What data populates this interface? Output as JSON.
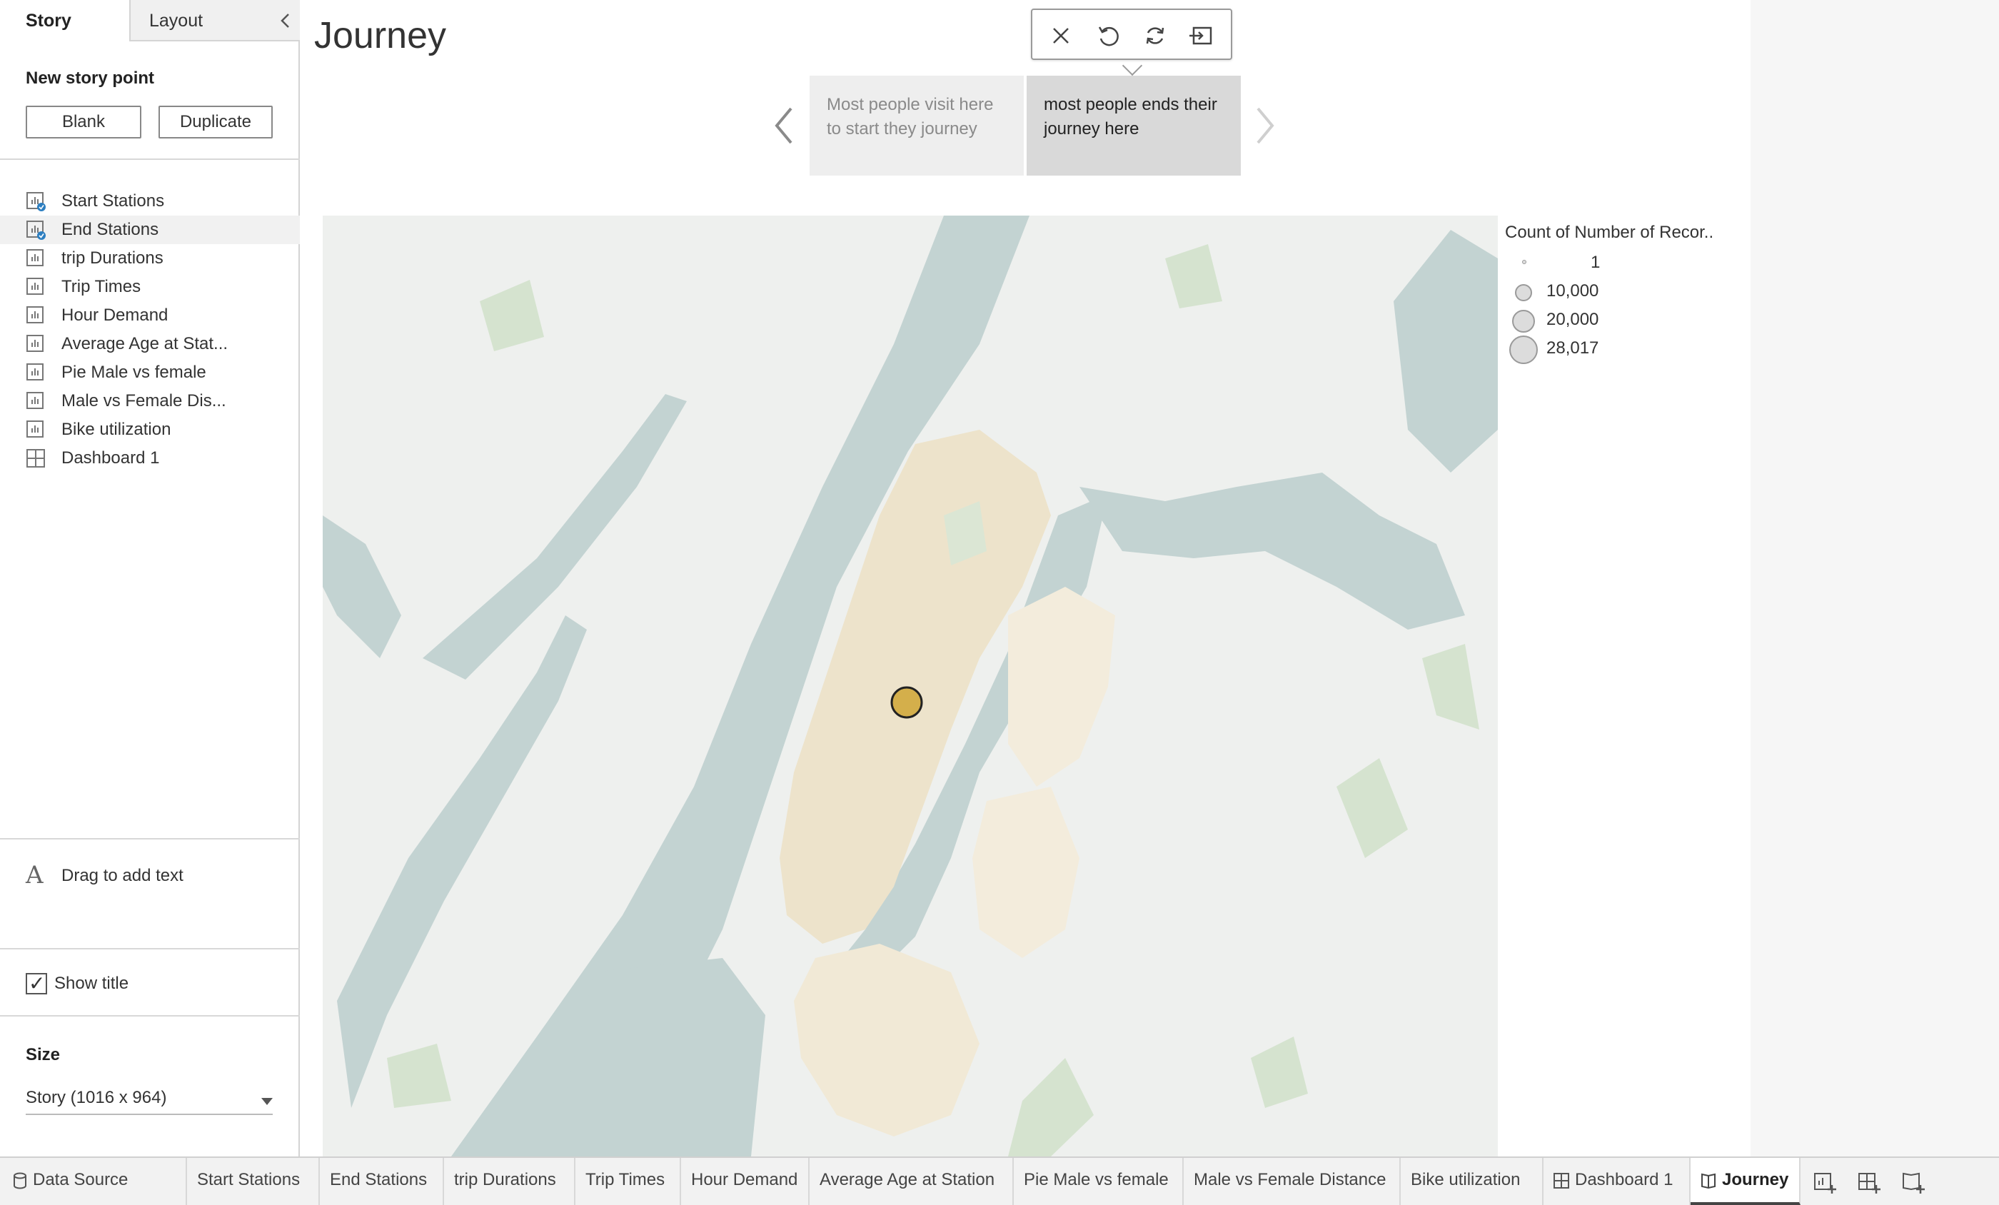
{
  "left_pane": {
    "tabs": {
      "story": "Story",
      "layout": "Layout"
    },
    "new_story_point": {
      "heading": "New story point",
      "blank_label": "Blank",
      "duplicate_label": "Duplicate"
    },
    "sheets": [
      {
        "label": "Start Stations",
        "icon": "worksheet-used-icon"
      },
      {
        "label": "End Stations",
        "icon": "worksheet-used-icon",
        "active": true
      },
      {
        "label": "trip Durations",
        "icon": "worksheet-icon"
      },
      {
        "label": "Trip Times",
        "icon": "worksheet-icon"
      },
      {
        "label": "Hour Demand",
        "icon": "worksheet-icon"
      },
      {
        "label": "Average Age at Stat...",
        "icon": "worksheet-icon"
      },
      {
        "label": "Pie Male vs female",
        "icon": "worksheet-icon"
      },
      {
        "label": "Male vs Female Dis...",
        "icon": "worksheet-icon"
      },
      {
        "label": "Bike utilization",
        "icon": "worksheet-icon"
      },
      {
        "label": "Dashboard 1",
        "icon": "dashboard-icon"
      }
    ],
    "drag_text": {
      "icon": "A",
      "label": "Drag to add text"
    },
    "show_title": {
      "label": "Show title",
      "checked": "✓"
    },
    "size": {
      "heading": "Size",
      "value": "Story (1016 x 964)"
    }
  },
  "story": {
    "title": "Journey",
    "story_points": [
      {
        "text": "Most people visit here to start they journey",
        "selected": false
      },
      {
        "text": "most people ends their journey here",
        "selected": true
      }
    ]
  },
  "legend": {
    "title": "Count of Number of Recor..",
    "items": [
      "1",
      "10,000",
      "20,000",
      "28,017"
    ]
  },
  "bottom_tabs": [
    {
      "label": "Data Source",
      "icon": "database-icon"
    },
    {
      "label": "Start Stations"
    },
    {
      "label": "End Stations"
    },
    {
      "label": "trip Durations"
    },
    {
      "label": "Trip Times"
    },
    {
      "label": "Hour Demand"
    },
    {
      "label": "Average Age at Station"
    },
    {
      "label": "Pie Male vs female"
    },
    {
      "label": "Male vs Female Distance"
    },
    {
      "label": "Bike utilization"
    },
    {
      "label": "Dashboard 1",
      "icon": "dashboard-icon"
    },
    {
      "label": "Journey",
      "icon": "story-icon",
      "active": true
    }
  ],
  "colors": {
    "water": "#c3d3d2",
    "land": "#eef0ee",
    "park": "#d5e3cf",
    "station_marks": "#ede3cb",
    "highlight_station": "#d4af4b",
    "accent": "#1f77b4"
  }
}
